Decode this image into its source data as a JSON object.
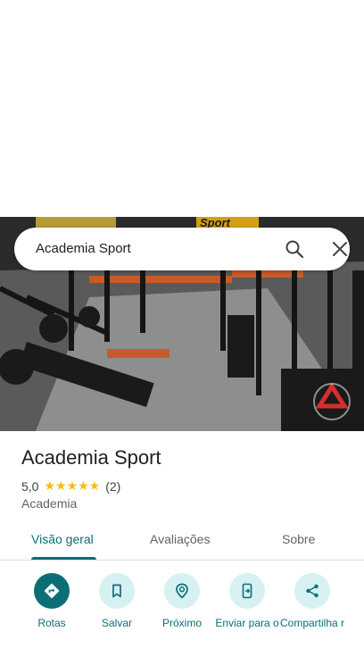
{
  "search": {
    "query": "Academia Sport"
  },
  "place": {
    "name": "Academia Sport",
    "rating": "5,0",
    "stars": "★★★★★",
    "review_count": "(2)",
    "category": "Academia"
  },
  "photo": {
    "sign_text": "Sport"
  },
  "tabs": [
    {
      "label": "Visão geral"
    },
    {
      "label": "Avaliações"
    },
    {
      "label": "Sobre"
    }
  ],
  "actions": [
    {
      "label": "Rotas",
      "icon": "directions-icon"
    },
    {
      "label": "Salvar",
      "icon": "bookmark-icon"
    },
    {
      "label": "Próximo",
      "icon": "nearby-icon"
    },
    {
      "label": "Enviar para o",
      "icon": "send-to-phone-icon"
    },
    {
      "label": "Compartilha r",
      "icon": "share-icon"
    }
  ],
  "colors": {
    "accent": "#0b6e75",
    "accent_light": "#d7f1f3",
    "star": "#fbbc04"
  }
}
